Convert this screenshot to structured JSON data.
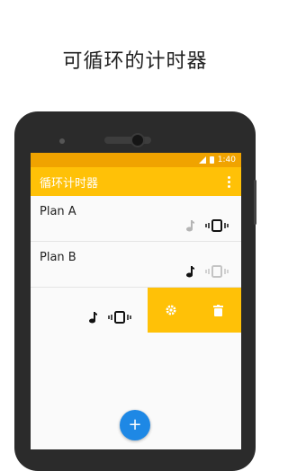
{
  "headline": "可循环的计时器",
  "status_bar": {
    "time": "1:40"
  },
  "app_bar": {
    "title": "循环计时器",
    "menu_icon": "more-vert-icon"
  },
  "plans": [
    {
      "name": "Plan A",
      "sound": "off",
      "vibrate": "on"
    },
    {
      "name": "Plan B",
      "sound": "on",
      "vibrate": "off"
    },
    {
      "name": "",
      "sound": "on",
      "vibrate": "on",
      "swiped": true
    }
  ],
  "swipe_actions": [
    {
      "icon": "settings-icon"
    },
    {
      "icon": "delete-icon"
    }
  ],
  "fab": {
    "label": "+"
  },
  "colors": {
    "accent": "#ffc107",
    "status_bar": "#f0a300",
    "fab": "#1e88e5"
  }
}
